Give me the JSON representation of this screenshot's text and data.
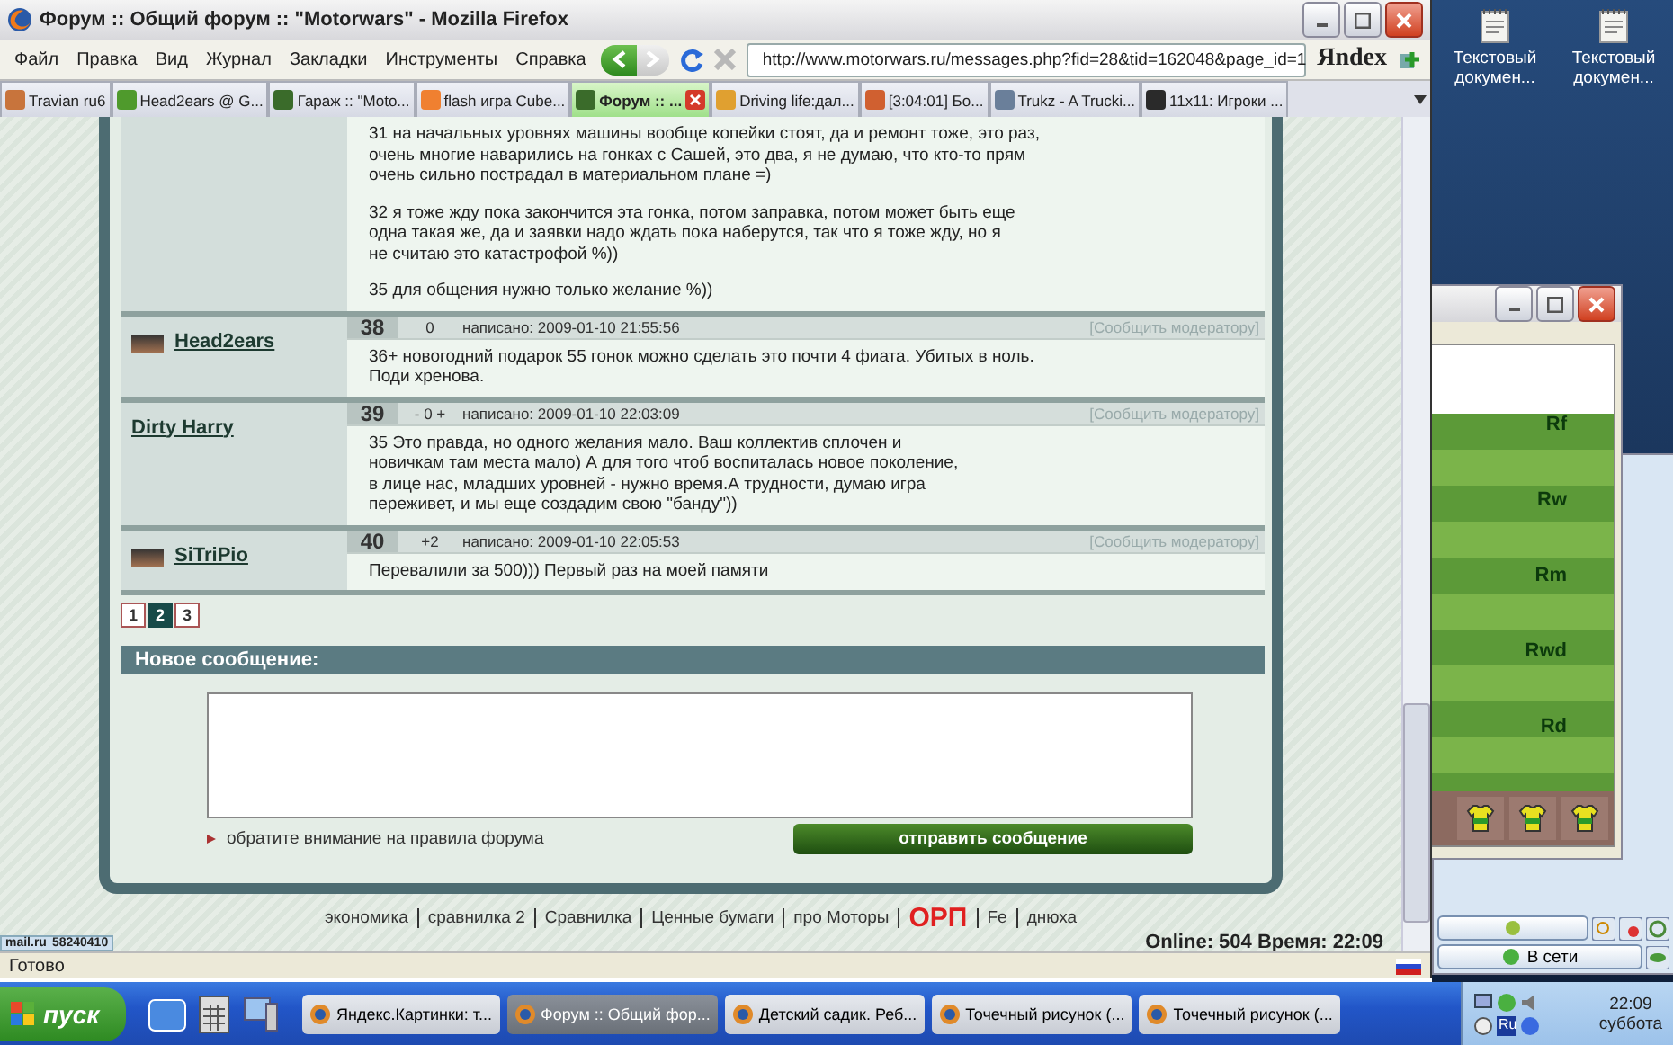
{
  "window": {
    "title": "Форум :: Общий форум :: \"Motorwars\" - Mozilla Firefox"
  },
  "menu": [
    "Файл",
    "Правка",
    "Вид",
    "Журнал",
    "Закладки",
    "Инструменты",
    "Справка"
  ],
  "address": {
    "value": "http://www.motorwars.ru/messages.php?fid=28&tid=162048&page_id=1"
  },
  "search_brand": "Яndex",
  "tabs": [
    {
      "label": "Travian ru6",
      "selected": false,
      "color": "#c8743c"
    },
    {
      "label": "Head2ears @ G...",
      "selected": false,
      "color": "#4f9a2c"
    },
    {
      "label": "Гараж :: \"Moto...",
      "selected": false,
      "color": "#3a6b2a"
    },
    {
      "label": "flash игра Cube...",
      "selected": false,
      "color": "#f08030"
    },
    {
      "label": "Форум :: ...",
      "selected": true,
      "color": "#3a6b2a"
    },
    {
      "label": "Driving life:дал...",
      "selected": false,
      "color": "#e0a030"
    },
    {
      "label": "[3:04:01]   Бо...",
      "selected": false,
      "color": "#d06030"
    },
    {
      "label": "Trukz - A Trucki...",
      "selected": false,
      "color": "#6a7f9a"
    },
    {
      "label": "11x11: Игроки ...",
      "selected": false,
      "color": "#2a2a2a"
    }
  ],
  "posts": [
    {
      "paragraphs": [
        "31 на начальных уровнях машины вообще копейки стоят, да и ремонт тоже, это раз,\nочень многие наварились на гонках с Сашей, это два, я не думаю, что кто-то прям\nочень сильно пострадал в материальном плане =)",
        "32 я тоже жду пока закончится эта гонка, потом заправка, потом может быть еще\nодна такая же, да и заявки надо ждать пока наберутся, так что я тоже жду, но я\nне считаю это катастрофой %))",
        "35 для общения нужно только желание %))"
      ]
    },
    {
      "author": "Head2ears",
      "avatar": true,
      "number": "38",
      "rating": "0",
      "date": "написано: 2009-01-10 21:55:56",
      "report": "[Сообщить модератору]",
      "paragraphs": [
        "36+ новогодний подарок 55 гонок можно сделать это почти 4 фиата. Убитых в ноль.\nПоди хренова."
      ]
    },
    {
      "author": "Dirty Harry",
      "avatar": false,
      "number": "39",
      "rating": "- 0 +",
      "date": "написано: 2009-01-10 22:03:09",
      "report": "[Сообщить модератору]",
      "paragraphs": [
        "35 Это правда, но одного желания мало. Ваш коллектив сплочен и\nновичкам там места мало) А для того чтоб воспиталась новое поколение,\nв лице нас, младших уровней - нужно время.А трудности, думаю игра\nпереживет, и мы еще создадим свою \"банду\"))"
      ]
    },
    {
      "author": "SiTriPio",
      "avatar": true,
      "number": "40",
      "rating": "+2",
      "date": "написано: 2009-01-10 22:05:53",
      "report": "[Сообщить модератору]",
      "paragraphs": [
        "Перевалили за 500))) Первый раз на моей памяти"
      ]
    }
  ],
  "pagination": [
    {
      "label": "1",
      "selected": false
    },
    {
      "label": "2",
      "selected": true
    },
    {
      "label": "3",
      "selected": false
    }
  ],
  "new_message": {
    "title": "Новое сообщение:",
    "rules_link": "обратите внимание на правила форума",
    "send_button": "отправить сообщение"
  },
  "footer_links": [
    {
      "label": "экономика",
      "kind": "link"
    },
    {
      "label": "сравнилка 2",
      "kind": "link"
    },
    {
      "label": "Сравнилка",
      "kind": "link"
    },
    {
      "label": "Ценные бумаги",
      "kind": "link"
    },
    {
      "label": "про Моторы",
      "kind": "link"
    },
    {
      "label": "ОРП",
      "kind": "highlight"
    },
    {
      "label": "Fe",
      "kind": "link"
    },
    {
      "label": "днюха",
      "kind": "link"
    }
  ],
  "counter": {
    "brand": "mail.ru",
    "count": "58240410"
  },
  "online": "Online: 504  Время: 22:09",
  "status_bar": "Готово",
  "desktop_icons": [
    "Текстовый докумен...",
    "Текстовый докумен..."
  ],
  "football": {
    "positions": [
      "Rf",
      "Rw",
      "Rm",
      "Rwd",
      "Rd"
    ]
  },
  "messenger": {
    "status": "В сети"
  },
  "taskbar": {
    "start": "пуск",
    "tasks": [
      {
        "label": "Яндекс.Картинки: т...",
        "selected": false
      },
      {
        "label": "Форум :: Общий фор...",
        "selected": true
      },
      {
        "label": "Детский садик. Реб...",
        "selected": false
      },
      {
        "label": "Точечный рисунок (...",
        "selected": false
      },
      {
        "label": "Точечный рисунок (...",
        "selected": false
      }
    ],
    "language": "Ru",
    "time": "22:09",
    "day": "суббота"
  }
}
